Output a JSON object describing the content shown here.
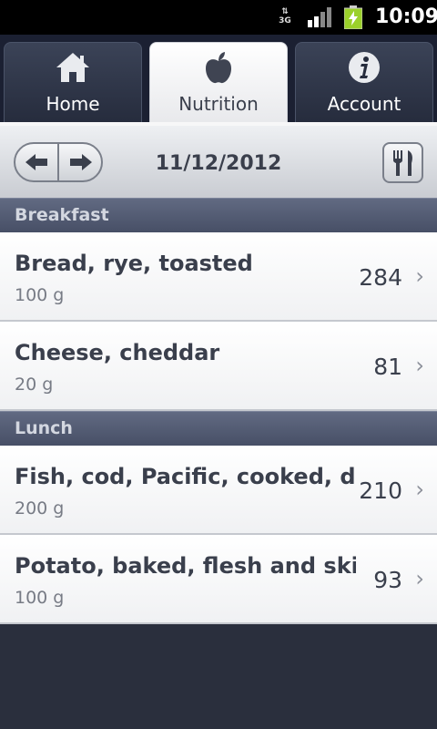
{
  "status_bar": {
    "network": "3G",
    "signal_icon": "signal-icon",
    "battery_icon": "battery-charging-icon",
    "time": "10:09"
  },
  "tabs": [
    {
      "label": "Home",
      "icon": "home-icon",
      "active": false
    },
    {
      "label": "Nutrition",
      "icon": "apple-icon",
      "active": true
    },
    {
      "label": "Account",
      "icon": "info-icon",
      "active": false
    }
  ],
  "toolbar": {
    "prev_icon": "arrow-left-icon",
    "next_icon": "arrow-right-icon",
    "date": "11/12/2012",
    "meal_icon": "fork-knife-icon"
  },
  "meals": [
    {
      "name": "Breakfast",
      "items": [
        {
          "name": "Bread, rye, toasted",
          "quantity": "100 g",
          "calories": "284"
        },
        {
          "name": "Cheese, cheddar",
          "quantity": "20 g",
          "calories": "81"
        }
      ]
    },
    {
      "name": "Lunch",
      "items": [
        {
          "name": "Fish, cod, Pacific, cooked, dry",
          "quantity": "200 g",
          "calories": "210"
        },
        {
          "name": "Potato, baked, flesh and skin, w",
          "quantity": "100 g",
          "calories": "93"
        }
      ]
    }
  ],
  "colors": {
    "background": "#2a2f3d",
    "header": "#474f66",
    "text": "#3a3f4c"
  }
}
